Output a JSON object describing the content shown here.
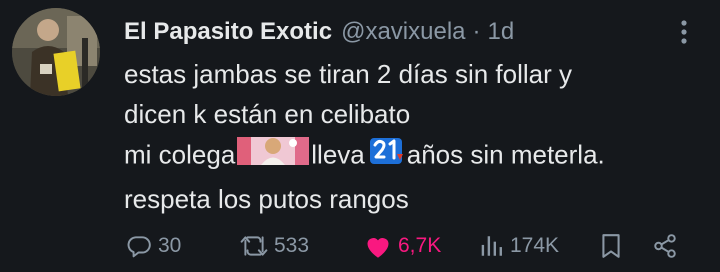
{
  "tweet": {
    "author": {
      "display_name": "El Papasito Exotic",
      "handle": "@xavixuela",
      "separator": "·",
      "timestamp": "1d"
    },
    "text": {
      "line1": "estas jambas se tiran 2 días sin follar y",
      "line2": "dicen k están en celibato",
      "line3_a": "mi colega",
      "line3_b": "lleva",
      "line3_c": "años sin meterla.",
      "line4": "respeta los putos rangos"
    },
    "inline_emojis": [
      "face-emoji",
      "number-21-emoji"
    ],
    "metrics": {
      "replies": "30",
      "reposts": "533",
      "likes": "6,7K",
      "views": "174K"
    },
    "liked": true,
    "colors": {
      "background": "#15181c",
      "text": "#e7e9ea",
      "secondary": "#8b98a5",
      "like": "#f91880"
    }
  }
}
